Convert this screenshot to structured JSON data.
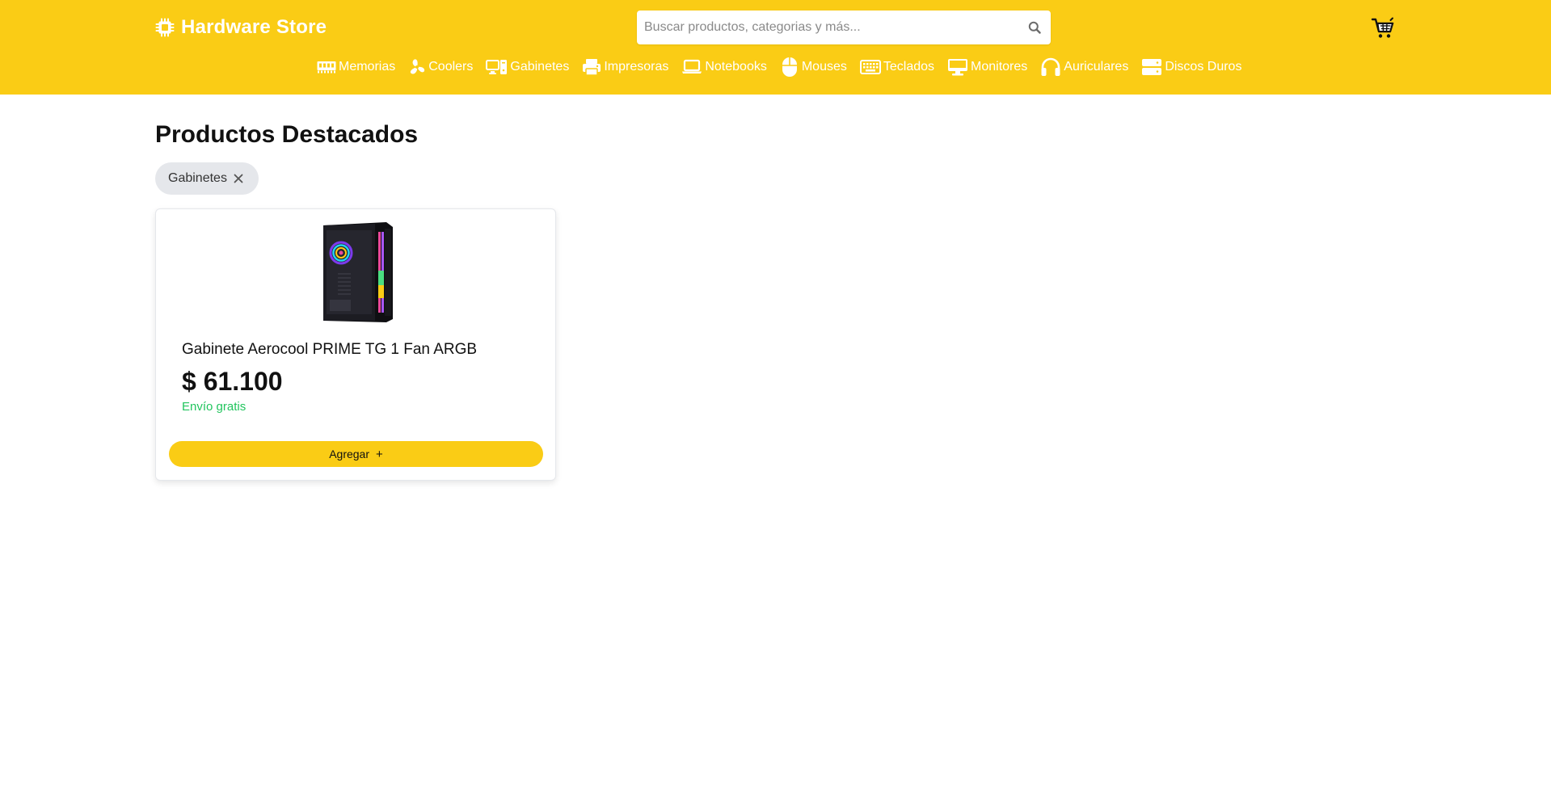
{
  "brand": {
    "name": "Hardware Store",
    "icon": "cpu-chip-icon",
    "color": "#facc15"
  },
  "search": {
    "placeholder": "Buscar productos, categorias y más...",
    "value": "",
    "icon": "search-icon"
  },
  "cart": {
    "icon": "shopping-cart-icon"
  },
  "nav": {
    "items": [
      {
        "label": "Memorias",
        "icon": "ram-memory-icon"
      },
      {
        "label": "Coolers",
        "icon": "fan-icon"
      },
      {
        "label": "Gabinetes",
        "icon": "desktop-computer-icon"
      },
      {
        "label": "Impresoras",
        "icon": "printer-icon"
      },
      {
        "label": "Notebooks",
        "icon": "laptop-icon"
      },
      {
        "label": "Mouses",
        "icon": "mouse-icon"
      },
      {
        "label": "Teclados",
        "icon": "keyboard-icon"
      },
      {
        "label": "Monitores",
        "icon": "monitor-icon"
      },
      {
        "label": "Auriculares",
        "icon": "headphones-icon"
      },
      {
        "label": "Discos Duros",
        "icon": "hard-drive-icon"
      }
    ]
  },
  "main": {
    "title": "Productos Destacados",
    "filter_chip": {
      "label": "Gabinetes",
      "icon": "close-icon"
    }
  },
  "products": [
    {
      "name": "Gabinete Aerocool PRIME TG 1 Fan ARGB",
      "price": "$ 61.100",
      "shipping": "Envío gratis",
      "shipping_color": "#22c55e",
      "button_label": "Agregar",
      "button_icon": "plus-icon"
    }
  ]
}
